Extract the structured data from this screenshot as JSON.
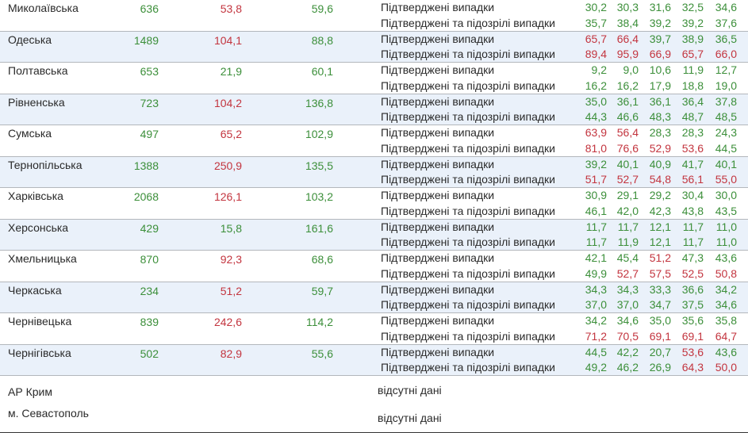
{
  "colors": {
    "green": "#3c8f3a",
    "red": "#c3353f",
    "row_alt": "#eaf1fa",
    "divider": "#b3b7bc"
  },
  "row_labels": {
    "confirmed": "Підтверджені випадки",
    "suspected": "Підтверджені та підозрілі випадки"
  },
  "regions": [
    {
      "name": "Миколаївська",
      "n1": "636",
      "n2": "53,8",
      "n3": "59,6",
      "n1c": "green",
      "n2c": "red",
      "n3c": "green",
      "confirmed": [
        [
          "30,2",
          "green"
        ],
        [
          "30,3",
          "green"
        ],
        [
          "31,6",
          "green"
        ],
        [
          "32,5",
          "green"
        ],
        [
          "34,6",
          "green"
        ]
      ],
      "suspected": [
        [
          "35,7",
          "green"
        ],
        [
          "38,4",
          "green"
        ],
        [
          "39,2",
          "green"
        ],
        [
          "39,2",
          "green"
        ],
        [
          "37,6",
          "green"
        ]
      ]
    },
    {
      "name": "Одеська",
      "n1": "1489",
      "n2": "104,1",
      "n3": "88,8",
      "n1c": "green",
      "n2c": "red",
      "n3c": "green",
      "confirmed": [
        [
          "65,7",
          "red"
        ],
        [
          "66,4",
          "red"
        ],
        [
          "39,7",
          "green"
        ],
        [
          "38,9",
          "green"
        ],
        [
          "36,5",
          "green"
        ]
      ],
      "suspected": [
        [
          "89,4",
          "red"
        ],
        [
          "95,9",
          "red"
        ],
        [
          "66,9",
          "red"
        ],
        [
          "65,7",
          "red"
        ],
        [
          "66,0",
          "red"
        ]
      ]
    },
    {
      "name": "Полтавська",
      "n1": "653",
      "n2": "21,9",
      "n3": "60,1",
      "n1c": "green",
      "n2c": "green",
      "n3c": "green",
      "confirmed": [
        [
          "9,2",
          "green"
        ],
        [
          "9,0",
          "green"
        ],
        [
          "10,6",
          "green"
        ],
        [
          "11,9",
          "green"
        ],
        [
          "12,7",
          "green"
        ]
      ],
      "suspected": [
        [
          "16,2",
          "green"
        ],
        [
          "16,2",
          "green"
        ],
        [
          "17,9",
          "green"
        ],
        [
          "18,8",
          "green"
        ],
        [
          "19,0",
          "green"
        ]
      ]
    },
    {
      "name": "Рівненська",
      "n1": "723",
      "n2": "104,2",
      "n3": "136,8",
      "n1c": "green",
      "n2c": "red",
      "n3c": "green",
      "confirmed": [
        [
          "35,0",
          "green"
        ],
        [
          "36,1",
          "green"
        ],
        [
          "36,1",
          "green"
        ],
        [
          "36,4",
          "green"
        ],
        [
          "37,8",
          "green"
        ]
      ],
      "suspected": [
        [
          "44,3",
          "green"
        ],
        [
          "46,6",
          "green"
        ],
        [
          "48,3",
          "green"
        ],
        [
          "48,7",
          "green"
        ],
        [
          "48,5",
          "green"
        ]
      ]
    },
    {
      "name": "Сумська",
      "n1": "497",
      "n2": "65,2",
      "n3": "102,9",
      "n1c": "green",
      "n2c": "red",
      "n3c": "green",
      "confirmed": [
        [
          "63,9",
          "red"
        ],
        [
          "56,4",
          "red"
        ],
        [
          "28,3",
          "green"
        ],
        [
          "28,3",
          "green"
        ],
        [
          "24,3",
          "green"
        ]
      ],
      "suspected": [
        [
          "81,0",
          "red"
        ],
        [
          "76,6",
          "red"
        ],
        [
          "52,9",
          "red"
        ],
        [
          "53,6",
          "red"
        ],
        [
          "44,5",
          "green"
        ]
      ]
    },
    {
      "name": "Тернопільська",
      "n1": "1388",
      "n2": "250,9",
      "n3": "135,5",
      "n1c": "green",
      "n2c": "red",
      "n3c": "green",
      "confirmed": [
        [
          "39,2",
          "green"
        ],
        [
          "40,1",
          "green"
        ],
        [
          "40,9",
          "green"
        ],
        [
          "41,7",
          "green"
        ],
        [
          "40,1",
          "green"
        ]
      ],
      "suspected": [
        [
          "51,7",
          "red"
        ],
        [
          "52,7",
          "red"
        ],
        [
          "54,8",
          "red"
        ],
        [
          "56,1",
          "red"
        ],
        [
          "55,0",
          "red"
        ]
      ]
    },
    {
      "name": "Харківська",
      "n1": "2068",
      "n2": "126,1",
      "n3": "103,2",
      "n1c": "green",
      "n2c": "red",
      "n3c": "green",
      "confirmed": [
        [
          "30,9",
          "green"
        ],
        [
          "29,1",
          "green"
        ],
        [
          "29,2",
          "green"
        ],
        [
          "30,4",
          "green"
        ],
        [
          "30,0",
          "green"
        ]
      ],
      "suspected": [
        [
          "46,1",
          "green"
        ],
        [
          "42,0",
          "green"
        ],
        [
          "42,3",
          "green"
        ],
        [
          "43,8",
          "green"
        ],
        [
          "43,5",
          "green"
        ]
      ]
    },
    {
      "name": "Херсонська",
      "n1": "429",
      "n2": "15,8",
      "n3": "161,6",
      "n1c": "green",
      "n2c": "green",
      "n3c": "green",
      "confirmed": [
        [
          "11,7",
          "green"
        ],
        [
          "11,7",
          "green"
        ],
        [
          "12,1",
          "green"
        ],
        [
          "11,7",
          "green"
        ],
        [
          "11,0",
          "green"
        ]
      ],
      "suspected": [
        [
          "11,7",
          "green"
        ],
        [
          "11,9",
          "green"
        ],
        [
          "12,1",
          "green"
        ],
        [
          "11,7",
          "green"
        ],
        [
          "11,0",
          "green"
        ]
      ]
    },
    {
      "name": "Хмельницька",
      "n1": "870",
      "n2": "92,3",
      "n3": "68,6",
      "n1c": "green",
      "n2c": "red",
      "n3c": "green",
      "confirmed": [
        [
          "42,1",
          "green"
        ],
        [
          "45,4",
          "green"
        ],
        [
          "51,2",
          "red"
        ],
        [
          "47,3",
          "green"
        ],
        [
          "43,6",
          "green"
        ]
      ],
      "suspected": [
        [
          "49,9",
          "green"
        ],
        [
          "52,7",
          "red"
        ],
        [
          "57,5",
          "red"
        ],
        [
          "52,5",
          "red"
        ],
        [
          "50,8",
          "red"
        ]
      ]
    },
    {
      "name": "Черкаська",
      "n1": "234",
      "n2": "51,2",
      "n3": "59,7",
      "n1c": "green",
      "n2c": "red",
      "n3c": "green",
      "confirmed": [
        [
          "34,3",
          "green"
        ],
        [
          "34,3",
          "green"
        ],
        [
          "33,3",
          "green"
        ],
        [
          "36,6",
          "green"
        ],
        [
          "34,2",
          "green"
        ]
      ],
      "suspected": [
        [
          "37,0",
          "green"
        ],
        [
          "37,0",
          "green"
        ],
        [
          "34,7",
          "green"
        ],
        [
          "37,5",
          "green"
        ],
        [
          "34,6",
          "green"
        ]
      ]
    },
    {
      "name": "Чернівецька",
      "n1": "839",
      "n2": "242,6",
      "n3": "114,2",
      "n1c": "green",
      "n2c": "red",
      "n3c": "green",
      "confirmed": [
        [
          "34,2",
          "green"
        ],
        [
          "34,6",
          "green"
        ],
        [
          "35,0",
          "green"
        ],
        [
          "35,6",
          "green"
        ],
        [
          "35,8",
          "green"
        ]
      ],
      "suspected": [
        [
          "71,2",
          "red"
        ],
        [
          "70,5",
          "red"
        ],
        [
          "69,1",
          "red"
        ],
        [
          "69,1",
          "red"
        ],
        [
          "64,7",
          "red"
        ]
      ]
    },
    {
      "name": "Чернігівська",
      "n1": "502",
      "n2": "82,9",
      "n3": "55,6",
      "n1c": "green",
      "n2c": "red",
      "n3c": "green",
      "confirmed": [
        [
          "44,5",
          "green"
        ],
        [
          "42,2",
          "green"
        ],
        [
          "20,7",
          "green"
        ],
        [
          "53,6",
          "red"
        ],
        [
          "43,6",
          "green"
        ]
      ],
      "suspected": [
        [
          "49,2",
          "green"
        ],
        [
          "46,2",
          "green"
        ],
        [
          "26,9",
          "green"
        ],
        [
          "64,3",
          "red"
        ],
        [
          "50,0",
          "red"
        ]
      ]
    }
  ],
  "bottom": [
    {
      "name": "АР Крим",
      "status": "відсутні дані"
    },
    {
      "name": "м. Севастополь",
      "status": "відсутні дані"
    }
  ]
}
